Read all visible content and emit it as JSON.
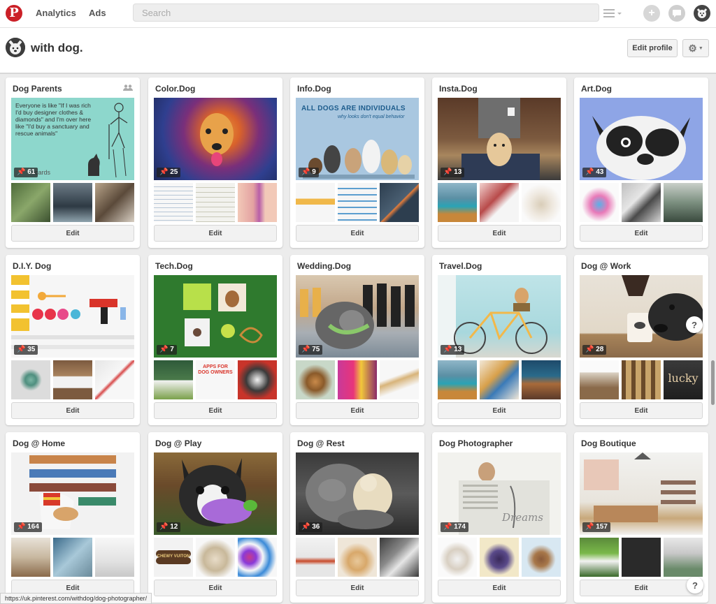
{
  "nav": {
    "analytics": "Analytics",
    "ads": "Ads",
    "search_placeholder": "Search"
  },
  "profile": {
    "name": "with dog.",
    "edit_profile": "Edit profile"
  },
  "edit_label": "Edit",
  "boards": [
    {
      "title": "Dog Parents",
      "pins": "61",
      "collab": true,
      "quote": "Everyone is like \"If I was rich I'd buy designer clothes & diamonds\" and I'm over here like \"I'd buy a sanctuary and rescue animals\"",
      "brand": "cards"
    },
    {
      "title": "Color.Dog",
      "pins": "25"
    },
    {
      "title": "Info.Dog",
      "pins": "9",
      "headline": "ALL DOGS ARE INDIVIDUALS",
      "subline": "why looks don't equal behavior"
    },
    {
      "title": "Insta.Dog",
      "pins": "13"
    },
    {
      "title": "Art.Dog",
      "pins": "43"
    },
    {
      "title": "D.I.Y. Dog",
      "pins": "35"
    },
    {
      "title": "Tech.Dog",
      "pins": "7",
      "thumb_caption": "APPS FOR DOG OWNERS"
    },
    {
      "title": "Wedding.Dog",
      "pins": "75"
    },
    {
      "title": "Travel.Dog",
      "pins": "13"
    },
    {
      "title": "Dog @ Work",
      "pins": "28",
      "thumb_caption": "lucky"
    },
    {
      "title": "Dog @ Home",
      "pins": "164"
    },
    {
      "title": "Dog @ Play",
      "pins": "12",
      "thumb_caption": "CHEWY VUITON"
    },
    {
      "title": "Dog @ Rest",
      "pins": "36"
    },
    {
      "title": "Dog Photographer",
      "pins": "174",
      "thumb_caption": "Dreams"
    },
    {
      "title": "Dog Boutique",
      "pins": "157"
    }
  ],
  "status_url": "https://uk.pinterest.com/withdog/dog-photographer/",
  "help_label": "?",
  "colors": {
    "brand": "#cb2027",
    "background": "#ececec"
  }
}
